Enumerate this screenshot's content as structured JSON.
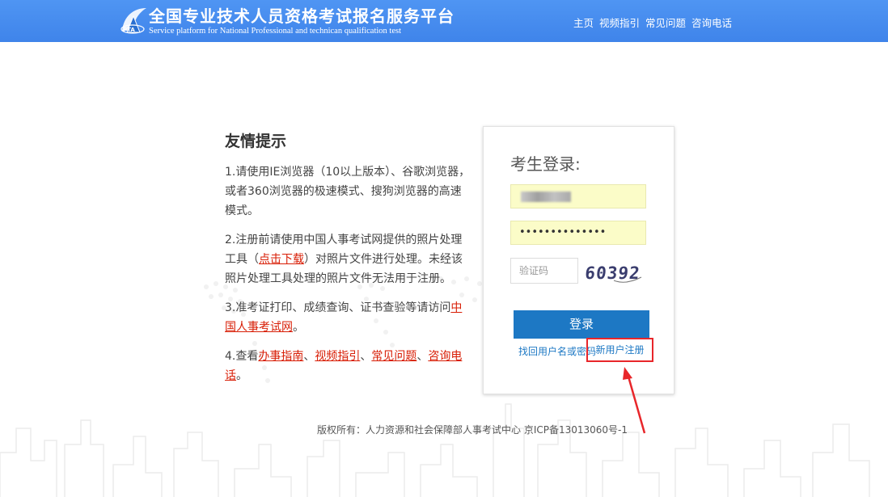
{
  "header": {
    "logo_text": "PTA",
    "title": "全国专业技术人员资格考试报名服务平台",
    "subtitle": "Service platform for National Professional and technican qualification test",
    "nav": [
      "主页",
      "视频指引",
      "常见问题",
      "咨询电话"
    ]
  },
  "tips": {
    "title": "友情提示",
    "tip1": "1.请使用IE浏览器（10以上版本）、谷歌浏览器，或者360浏览器的极速模式、搜狗浏览器的高速模式。",
    "tip2_before": "2.注册前请使用中国人事考试网提供的照片处理工具（",
    "tip2_link": "点击下载",
    "tip2_after": "）对照片文件进行处理。未经该照片处理工具处理的照片文件无法用于注册。",
    "tip3_before": "3.准考证打印、成绩查询、证书查验等请访问",
    "tip3_link": "中国人事考试网",
    "tip3_after": "。",
    "tip4_before": "4.查看",
    "tip4_links": [
      "办事指南",
      "视频指引",
      "常见问题",
      "咨询电话"
    ],
    "tip4_sep": "、",
    "tip4_after": "。"
  },
  "login": {
    "title": "考生登录:",
    "password_mask": "••••••••••••••",
    "captcha_placeholder": "验证码",
    "captcha_text": "60392",
    "login_button": "登录",
    "forgot_link": "找回用户名或密码",
    "register_link": "新用户注册"
  },
  "footer": {
    "copyright": "版权所有：人力资源和社会保障部人事考试中心 京ICP备13013060号-1"
  },
  "colors": {
    "header_bg": "#4a8ff0",
    "button_bg": "#1d78c4",
    "link_red": "#d81e06",
    "highlight_red": "#e8262a",
    "autofill_yellow": "#fbfcc8"
  }
}
